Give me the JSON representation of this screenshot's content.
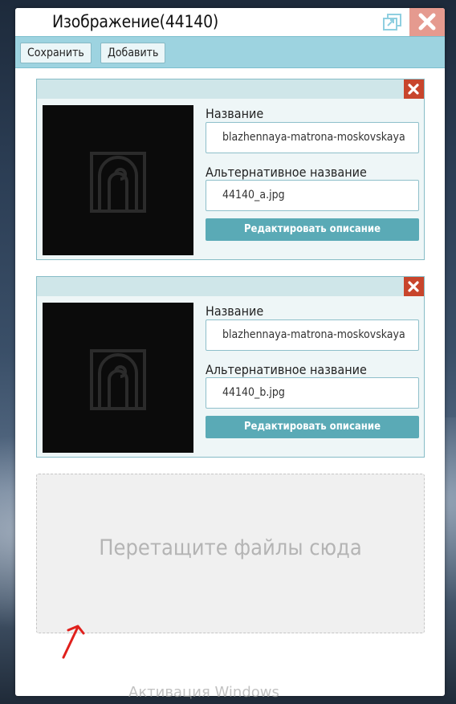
{
  "window": {
    "title": "Изображение(44140)",
    "popout_icon": "popout-icon",
    "close_icon": "close-icon",
    "accent_color": "#9dd3e0",
    "close_color": "#e59a8f"
  },
  "toolbar": {
    "save_label": "Сохранить",
    "add_label": "Добавить"
  },
  "images": [
    {
      "name_label": "Название",
      "name_value": "blazhennaya-matrona-moskovskaya",
      "alt_label": "Альтернативное название",
      "alt_value": "44140_a.jpg",
      "edit_label": "Редактировать описание",
      "delete_icon": "delete-icon"
    },
    {
      "name_label": "Название",
      "name_value": "blazhennaya-matrona-moskovskaya",
      "alt_label": "Альтернативное название",
      "alt_value": "44140_b.jpg",
      "edit_label": "Редактировать описание",
      "delete_icon": "delete-icon"
    }
  ],
  "dropzone": {
    "text": "Перетащите файлы сюда"
  },
  "os_overlay": {
    "watermark": "Активация Windows"
  }
}
